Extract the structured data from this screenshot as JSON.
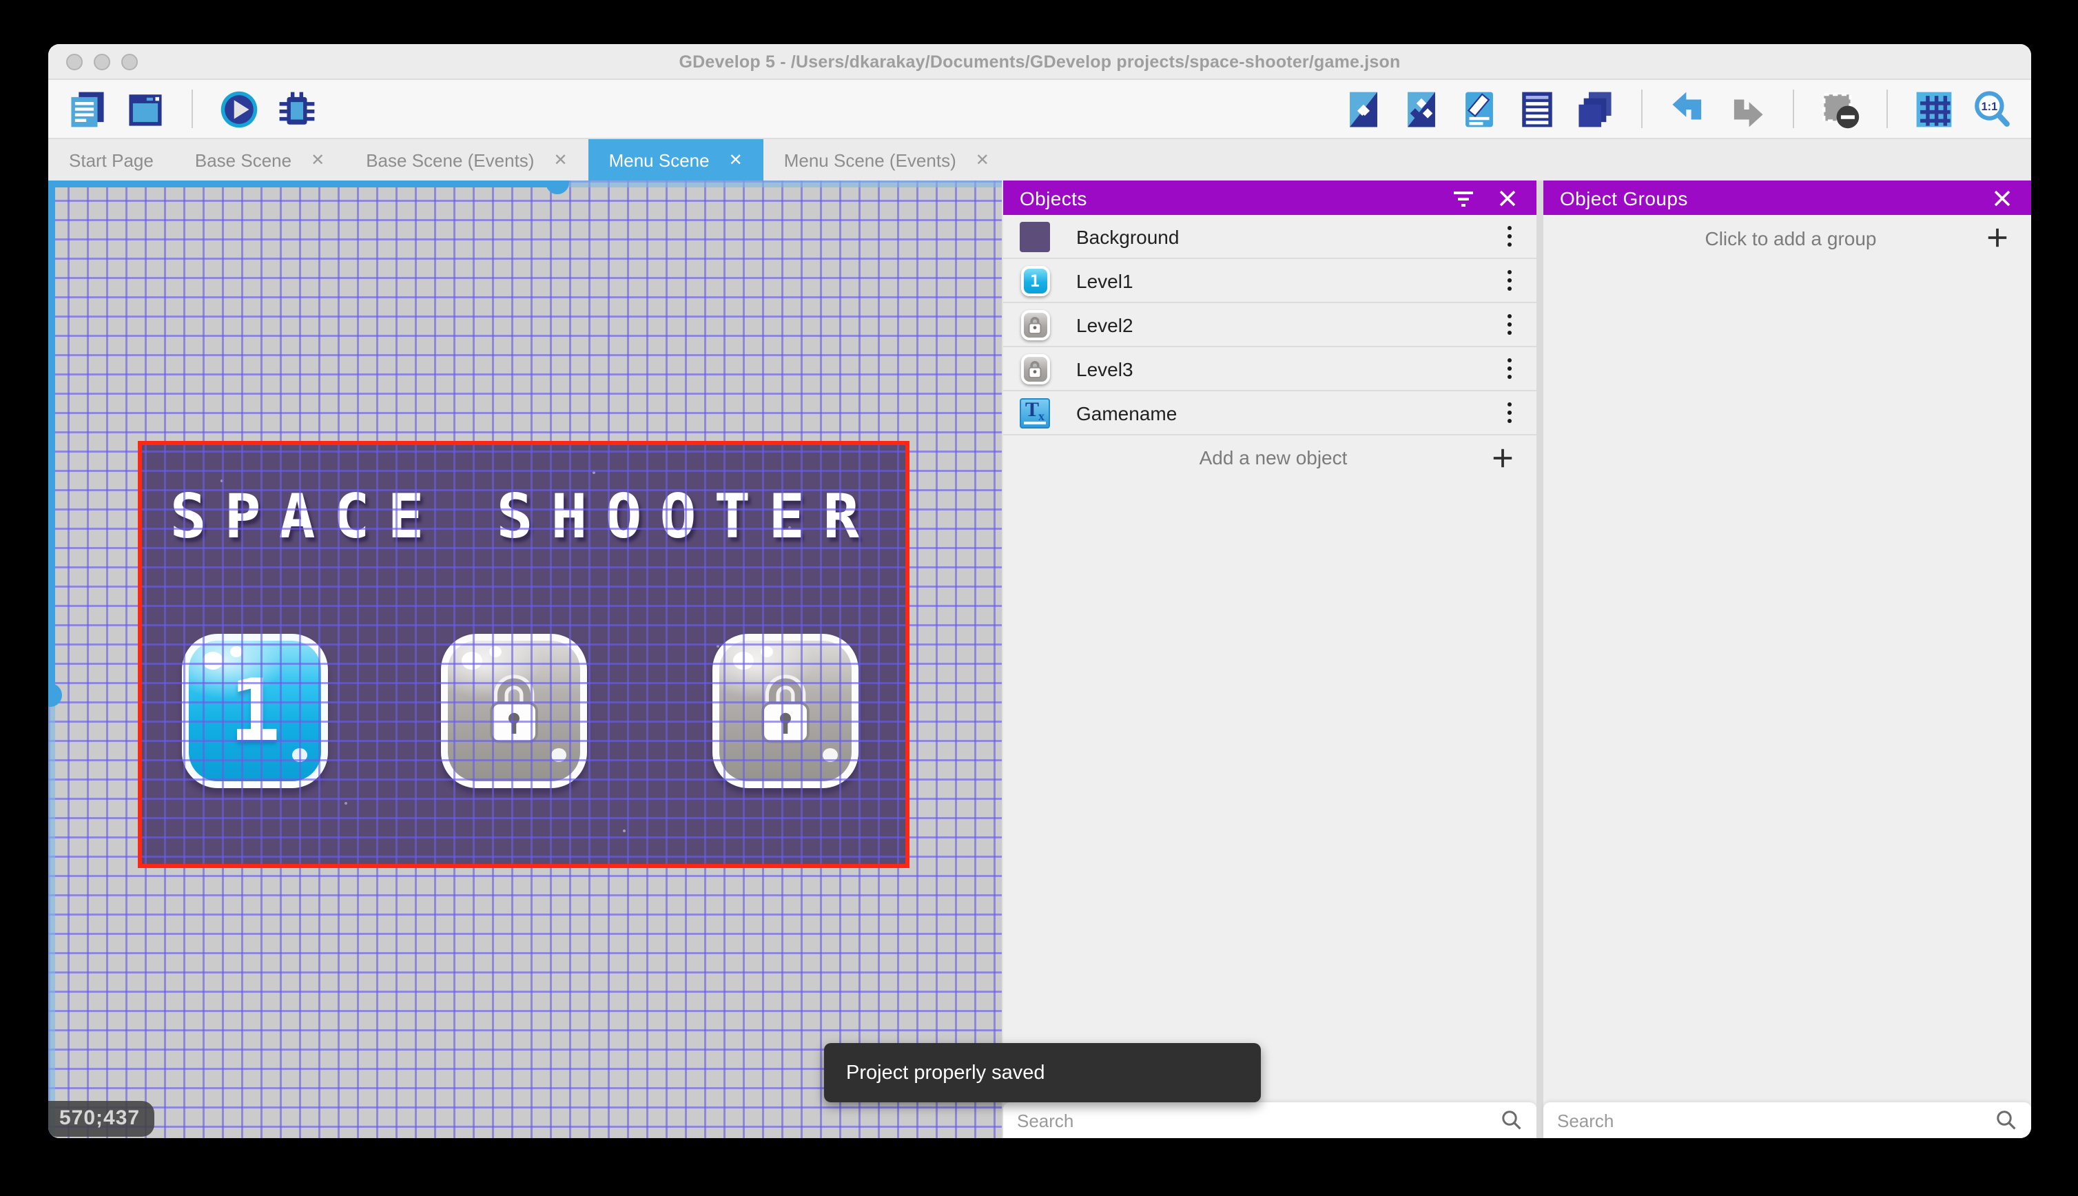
{
  "window_title": "GDevelop 5 - /Users/dkarakay/Documents/GDevelop projects/space-shooter/game.json",
  "toolbar": {
    "left_icons": [
      "project-manager-icon",
      "scenes-icon",
      "play-icon",
      "debug-icon"
    ],
    "right_icons": [
      "objects-editor-icon",
      "object-groups-editor-icon",
      "properties-icon",
      "instances-list-icon",
      "layers-icon",
      "undo-icon",
      "redo-icon",
      "window-mask-icon",
      "grid-icon",
      "zoom-original-icon"
    ]
  },
  "tabs": [
    {
      "label": "Start Page",
      "closable": false,
      "active": false
    },
    {
      "label": "Base Scene",
      "closable": true,
      "active": false
    },
    {
      "label": "Base Scene (Events)",
      "closable": true,
      "active": false
    },
    {
      "label": "Menu Scene",
      "closable": true,
      "active": true
    },
    {
      "label": "Menu Scene (Events)",
      "closable": true,
      "active": false
    }
  ],
  "scene_canvas": {
    "cursor_coordinates": "570;437",
    "game_title_text": "SPACE SHOOTER",
    "level_buttons": [
      {
        "label": "1",
        "state": "unlocked"
      },
      {
        "label": "",
        "state": "locked"
      },
      {
        "label": "",
        "state": "locked"
      }
    ]
  },
  "objects_panel": {
    "title": "Objects",
    "items": [
      {
        "name": "Background",
        "icon": "background-thumbnail"
      },
      {
        "name": "Level1",
        "icon": "level1-button-thumbnail"
      },
      {
        "name": "Level2",
        "icon": "locked-button-thumbnail"
      },
      {
        "name": "Level3",
        "icon": "locked-button-thumbnail"
      },
      {
        "name": "Gamename",
        "icon": "text-object-thumbnail"
      }
    ],
    "add_button_label": "Add a new object",
    "search_placeholder": "Search"
  },
  "object_groups_panel": {
    "title": "Object Groups",
    "add_button_label": "Click to add a group",
    "search_placeholder": "Search"
  },
  "snackbar": {
    "message": "Project properly saved"
  },
  "icons_text": {
    "gamename_T": "T",
    "gamename_x": "x",
    "level1_thumb_digit": "1"
  },
  "colors": {
    "panel_header_purple": "#9d0ac6",
    "active_tab_blue": "#45aae4",
    "scene_background": "#594a73",
    "grid_line_blue": "#685ee0",
    "scene_border_red": "#ff2613",
    "scrollbar_blue": "#3fa2e0",
    "snackbar_dark": "#303030"
  }
}
